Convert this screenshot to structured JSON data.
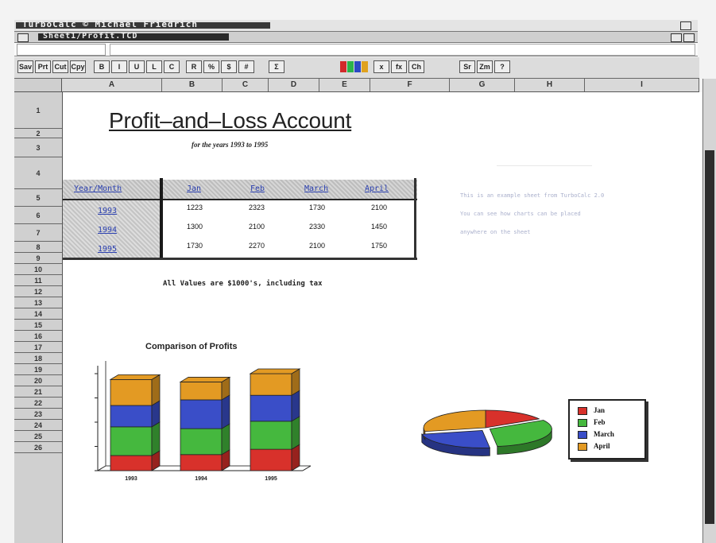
{
  "app": {
    "window_title": "TurboCalc  © Michael Friedrich",
    "sheet_title": "Sheet1/Profit.TCD"
  },
  "toolbar": {
    "buttons": [
      "Sav",
      "Prt",
      "Cut",
      "Cpy",
      "B",
      "I",
      "U",
      "L",
      "C",
      "R",
      "%",
      "$",
      "#",
      "Σ",
      "x",
      "fx",
      "Ch",
      "Sr",
      "Zm",
      "?"
    ],
    "swatches": [
      "#d22a2a",
      "#2bb34a",
      "#2b49c4",
      "#e0a21f"
    ]
  },
  "columns": [
    "A",
    "B",
    "C",
    "D",
    "E",
    "F",
    "G",
    "H",
    "I"
  ],
  "rows": [
    "1",
    "2",
    "3",
    "4",
    "5",
    "6",
    "7",
    "8",
    "9",
    "10",
    "11",
    "12",
    "13",
    "14",
    "15",
    "16",
    "17",
    "18",
    "19",
    "20",
    "21",
    "22",
    "23",
    "24",
    "25",
    "26"
  ],
  "sheet": {
    "title": "Profit–and–Loss Account",
    "subtitle": "for the years 1993 to 1995",
    "table_header": [
      "Year/Month",
      "Jan",
      "Feb",
      "March",
      "April"
    ],
    "table_rows": [
      {
        "year": "1993",
        "values": [
          "1223",
          "2323",
          "1730",
          "2100"
        ]
      },
      {
        "year": "1994",
        "values": [
          "1300",
          "2100",
          "2330",
          "1450"
        ]
      },
      {
        "year": "1995",
        "values": [
          "1730",
          "2270",
          "2100",
          "1750"
        ]
      }
    ],
    "note": "All Values are $1000's, including tax",
    "side_note_lines": [
      "This is an example sheet from TurboCalc 2.0",
      "You can see how charts can be placed",
      "anywhere on the sheet"
    ]
  },
  "chart_data": [
    {
      "type": "bar",
      "stacked": true,
      "title": "Comparison of Profits",
      "categories": [
        "1993",
        "1994",
        "1995"
      ],
      "series": [
        {
          "name": "Jan",
          "color": "#d8312b",
          "values": [
            1223,
            1300,
            1730
          ]
        },
        {
          "name": "Feb",
          "color": "#45b83e",
          "values": [
            2323,
            2100,
            2270
          ]
        },
        {
          "name": "March",
          "color": "#3a4ec8",
          "values": [
            1730,
            2330,
            2100
          ]
        },
        {
          "name": "April",
          "color": "#e39a23",
          "values": [
            2100,
            1450,
            1750
          ]
        }
      ]
    },
    {
      "type": "pie",
      "slices": [
        {
          "label": "Jan",
          "value": 1223,
          "color": "#d8312b"
        },
        {
          "label": "Feb",
          "value": 2323,
          "color": "#45b83e"
        },
        {
          "label": "March",
          "value": 1730,
          "color": "#3a4ec8"
        },
        {
          "label": "April",
          "value": 2100,
          "color": "#e39a23"
        }
      ],
      "legend_position": "right",
      "legend": [
        "Jan",
        "Feb",
        "March",
        "April"
      ]
    }
  ]
}
